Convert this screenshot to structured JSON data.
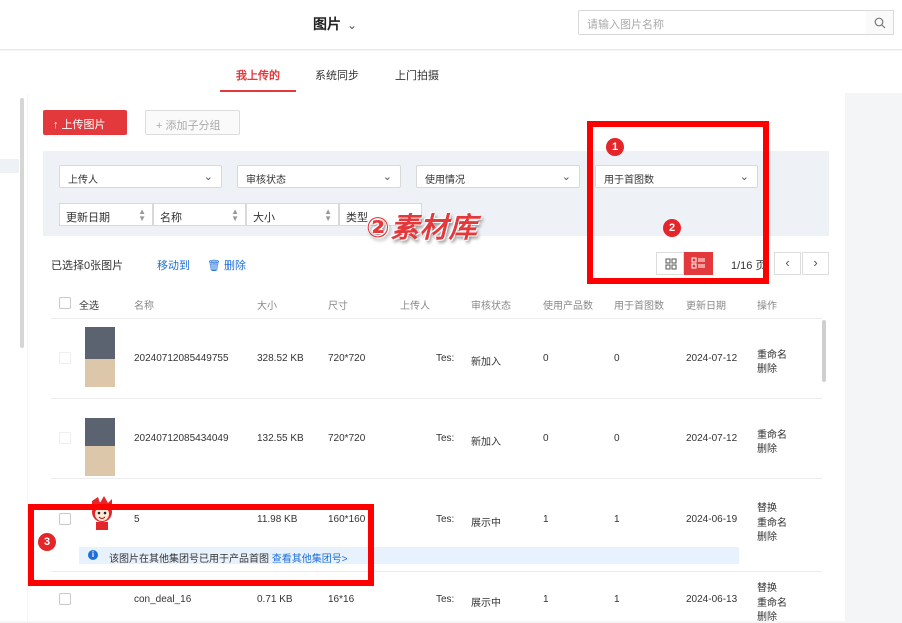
{
  "header": {
    "title": "图片",
    "title_chevron": "⌄",
    "search_placeholder": "请输入图片名称"
  },
  "tabs": [
    {
      "label": "我上传的",
      "active": true
    },
    {
      "label": "系统同步",
      "active": false
    },
    {
      "label": "上门拍摄",
      "active": false
    }
  ],
  "toolbar": {
    "upload_label": "↑ 上传图片",
    "add_subgroup_label": "+ 添加子分组"
  },
  "filters": {
    "uploader": "上传人",
    "review_status": "审核状态",
    "usage": "使用情况",
    "used_for_cover": "用于首图数",
    "sorts": [
      "更新日期",
      "名称",
      "大小",
      "类型"
    ]
  },
  "selection": {
    "selected_text": "已选择0张图片",
    "move_label": "移动到",
    "delete_label": "删除"
  },
  "pager": {
    "text": "1/16 页"
  },
  "table": {
    "headers": [
      "全选",
      "名称",
      "大小",
      "尺寸",
      "上传人",
      "审核状态",
      "使用产品数",
      "用于首图数",
      "更新日期",
      "操作"
    ],
    "rows": [
      {
        "name": "20240712085449755",
        "size": "328.52 KB",
        "dims": "720*720",
        "uploader": "Tes:",
        "status": "新加入",
        "products": "0",
        "covers": "0",
        "date": "2024-07-12",
        "actions": [
          "重命名",
          "删除"
        ]
      },
      {
        "name": "20240712085434049",
        "size": "132.55 KB",
        "dims": "720*720",
        "uploader": "Tes:",
        "status": "新加入",
        "products": "0",
        "covers": "0",
        "date": "2024-07-12",
        "actions": [
          "重命名",
          "删除"
        ]
      },
      {
        "name": "5",
        "size": "11.98 KB",
        "dims": "160*160",
        "uploader": "Tes:",
        "status": "展示中",
        "products": "1",
        "covers": "1",
        "date": "2024-06-19",
        "actions": [
          "替换",
          "重命名",
          "删除"
        ]
      },
      {
        "name": "con_deal_16",
        "size": "0.71 KB",
        "dims": "16*16",
        "uploader": "Tes:",
        "status": "展示中",
        "products": "1",
        "covers": "1",
        "date": "2024-06-13",
        "actions": [
          "替换",
          "重命名",
          "删除"
        ]
      }
    ]
  },
  "notice": {
    "text": "该图片在其他集团号已用于产品首图",
    "link": "查看其他集团号>"
  },
  "markers": [
    "1",
    "2",
    "3"
  ],
  "watermark": "②素材库",
  "colors": {
    "accent": "#e4393c",
    "link": "#1e6fd9",
    "annotation": "#ff0000"
  }
}
